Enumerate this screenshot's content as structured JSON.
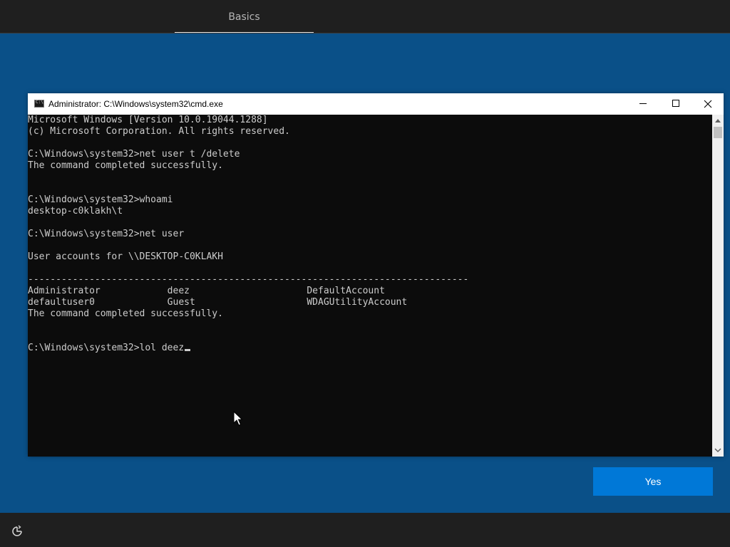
{
  "oobe": {
    "tab_label": "Basics",
    "yes_label": "Yes",
    "accent_color": "#0078d7",
    "background_color": "#0a5088",
    "bottom_icon": "ease-of-access-icon"
  },
  "cmd": {
    "title": "Administrator: C:\\Windows\\system32\\cmd.exe",
    "lines": [
      "Microsoft Windows [Version 10.0.19044.1288]",
      "(c) Microsoft Corporation. All rights reserved.",
      "",
      "C:\\Windows\\system32>net user t /delete",
      "The command completed successfully.",
      "",
      "",
      "C:\\Windows\\system32>whoami",
      "desktop-c0klakh\\t",
      "",
      "C:\\Windows\\system32>net user",
      "",
      "User accounts for \\\\DESKTOP-C0KLAKH",
      "",
      "-------------------------------------------------------------------------------",
      "Administrator            deez                     DefaultAccount",
      "defaultuser0             Guest                    WDAGUtilityAccount",
      "The command completed successfully.",
      "",
      "",
      "C:\\Windows\\system32>lol deez"
    ]
  }
}
